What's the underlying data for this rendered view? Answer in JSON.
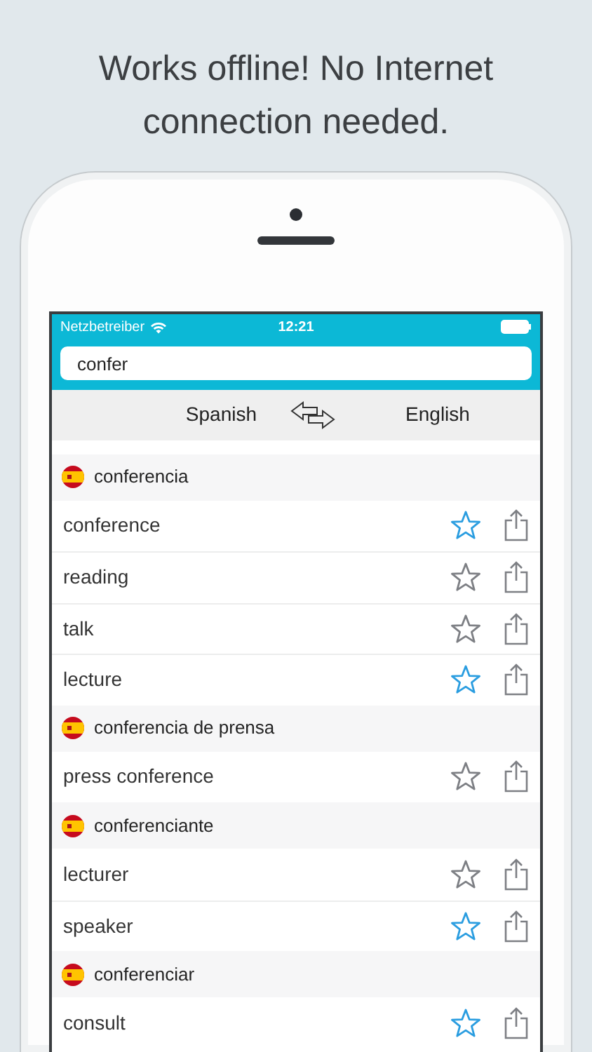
{
  "headline": "Works offline! No Internet connection needed.",
  "status_bar": {
    "carrier": "Netzbetreiber",
    "time": "12:21"
  },
  "search": {
    "value": "confer"
  },
  "languages": {
    "source": "Spanish",
    "target": "English"
  },
  "entries": [
    {
      "word": "conferencia",
      "translations": [
        {
          "text": "conference",
          "favorite": true
        },
        {
          "text": "reading",
          "favorite": false
        },
        {
          "text": "talk",
          "favorite": false
        },
        {
          "text": "lecture",
          "favorite": true
        }
      ]
    },
    {
      "word": "conferencia de prensa",
      "translations": [
        {
          "text": "press conference",
          "favorite": false
        }
      ]
    },
    {
      "word": "conferenciante",
      "translations": [
        {
          "text": "lecturer",
          "favorite": false
        },
        {
          "text": "speaker",
          "favorite": true
        }
      ]
    },
    {
      "word": "conferenciar",
      "translations": [
        {
          "text": "consult",
          "favorite": true
        }
      ]
    }
  ]
}
